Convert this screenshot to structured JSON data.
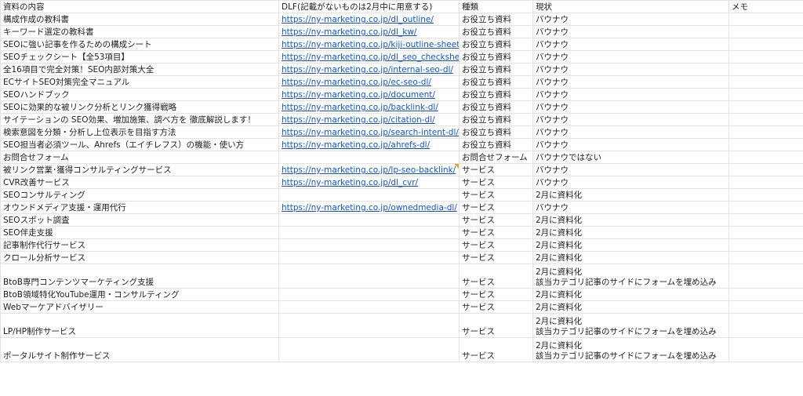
{
  "header": {
    "content": "資料の内容",
    "dlf": "DLF(記載がないものは2月中に用意する)",
    "type": "種類",
    "status": "現状",
    "memo": "メモ"
  },
  "rows": [
    {
      "content": "構成作成の教科書",
      "url": "https://ny-marketing.co.jp/dl_outline/",
      "type": "お役立ち資料",
      "status": [
        "バウナウ"
      ],
      "memo": ""
    },
    {
      "content": "キーワード選定の教科書",
      "url": "https://ny-marketing.co.jp/dl_kw/",
      "type": "お役立ち資料",
      "status": [
        "バウナウ"
      ],
      "memo": ""
    },
    {
      "content": "SEOに強い記事を作るための構成シート",
      "url": "https://ny-marketing.co.jp/kiji-outline-sheet-dl/",
      "type": "お役立ち資料",
      "status": [
        "バウナウ"
      ],
      "memo": ""
    },
    {
      "content": "SEOチェックシート【全53項目】",
      "url": "https://ny-marketing.co.jp/dl_seo_checksheet/",
      "type": "お役立ち資料",
      "status": [
        "バウナウ"
      ],
      "memo": ""
    },
    {
      "content": "全16項目で完全対策！SEO内部対策大全",
      "url": "https://ny-marketing.co.jp/internal-seo-dl/",
      "type": "お役立ち資料",
      "status": [
        "バウナウ"
      ],
      "memo": ""
    },
    {
      "content": "ECサイトSEO対策完全マニュアル",
      "url": "https://ny-marketing.co.jp/ec-seo-dl/",
      "type": "お役立ち資料",
      "status": [
        "バウナウ"
      ],
      "memo": ""
    },
    {
      "content": "SEOハンドブック",
      "url": "https://ny-marketing.co.jp/document/",
      "type": "お役立ち資料",
      "status": [
        "バウナウ"
      ],
      "memo": ""
    },
    {
      "content": "SEOに効果的な被リンク分析とリンク獲得戦略",
      "url": "https://ny-marketing.co.jp/backlink-dl/",
      "type": "お役立ち資料",
      "status": [
        "バウナウ"
      ],
      "memo": ""
    },
    {
      "content": "サイテーションの SEO効果、増加施策、調べ方を 徹底解説します！",
      "url": "https://ny-marketing.co.jp/citation-dl/",
      "type": "お役立ち資料",
      "status": [
        "バウナウ"
      ],
      "memo": ""
    },
    {
      "content": "検索意図を分類・分析し上位表示を目指す方法",
      "url": "https://ny-marketing.co.jp/search-intent-dl/",
      "type": "お役立ち資料",
      "status": [
        "バウナウ"
      ],
      "memo": ""
    },
    {
      "content": "SEO担当者必須ツール、Ahrefs（エイチレフス）の機能・使い方",
      "url": "https://ny-marketing.co.jp/ahrefs-dl/",
      "type": "お役立ち資料",
      "status": [
        "バウナウ"
      ],
      "memo": ""
    },
    {
      "content": "お問合せフォーム",
      "url": "",
      "type": "お問合せフォーム",
      "status": [
        "バウナウではない"
      ],
      "memo": ""
    },
    {
      "content": "被リンク営業･獲得コンサルティングサービス",
      "url": "https://ny-marketing.co.jp/lp-seo-backlink/",
      "type": "サービス",
      "status": [
        "バウナウ"
      ],
      "memo": ""
    },
    {
      "content": "CVR改善サービス",
      "url": "https://ny-marketing.co.jp/dl_cvr/",
      "type": "サービス",
      "status": [
        "バウナウ"
      ],
      "memo": ""
    },
    {
      "content": "SEOコンサルティング",
      "url": "",
      "type": "サービス",
      "status": [
        "2月に資料化"
      ],
      "memo": ""
    },
    {
      "content": "オウンドメディア支援・運用代行",
      "url": "https://ny-marketing.co.jp/ownedmedia-dl/",
      "type": "サービス",
      "status": [
        "バウナウ"
      ],
      "memo": ""
    },
    {
      "content": "SEOスポット調査",
      "url": "",
      "type": "サービス",
      "status": [
        "2月に資料化"
      ],
      "memo": ""
    },
    {
      "content": "SEO伴走支援",
      "url": "",
      "type": "サービス",
      "status": [
        "2月に資料化"
      ],
      "memo": ""
    },
    {
      "content": "記事制作代行サービス",
      "url": "",
      "type": "サービス",
      "status": [
        "2月に資料化"
      ],
      "memo": ""
    },
    {
      "content": "クロール分析サービス",
      "url": "",
      "type": "サービス",
      "status": [
        "2月に資料化"
      ],
      "memo": ""
    },
    {
      "content": "BtoB専門コンテンツマーケティング支援",
      "url": "",
      "type": "サービス",
      "status": [
        "2月に資料化",
        "該当カテゴリ記事のサイドにフォームを埋め込み"
      ],
      "memo": ""
    },
    {
      "content": "BtoB領域特化YouTube運用・コンサルティング",
      "url": "",
      "type": "サービス",
      "status": [
        "2月に資料化"
      ],
      "memo": ""
    },
    {
      "content": "Webマーケアドバイザリー",
      "url": "",
      "type": "サービス",
      "status": [
        "2月に資料化"
      ],
      "memo": ""
    },
    {
      "content": "LP/HP制作サービス",
      "url": "",
      "type": "サービス",
      "status": [
        "2月に資料化",
        "該当カテゴリ記事のサイドにフォームを埋め込み"
      ],
      "memo": ""
    },
    {
      "content": "ポータルサイト制作サービス",
      "url": "",
      "type": "サービス",
      "status": [
        "2月に資料化",
        "該当カテゴリ記事のサイドにフォームを埋め込み"
      ],
      "memo": ""
    }
  ]
}
